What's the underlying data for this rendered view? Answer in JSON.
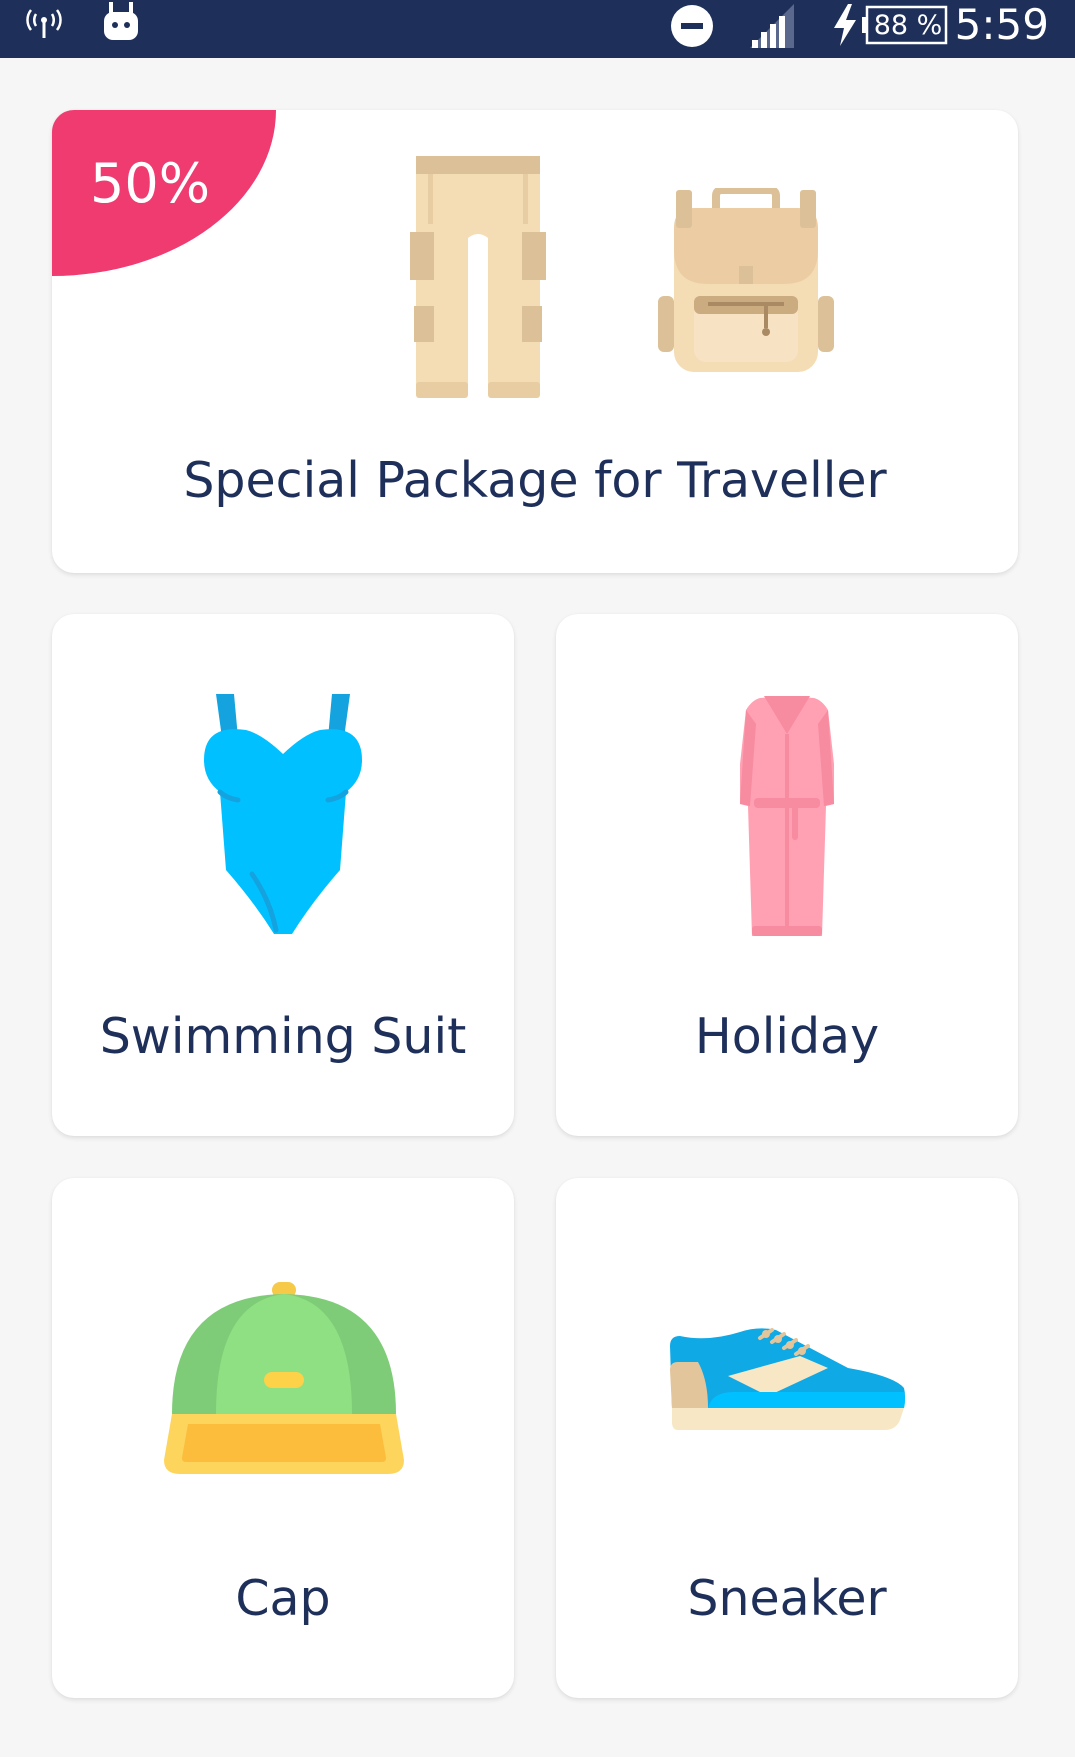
{
  "status_bar": {
    "time": "5:59",
    "battery": "88 %",
    "icons": [
      "hotspot-icon",
      "android-debug-icon",
      "do-not-disturb-icon",
      "signal-icon",
      "charging-icon",
      "battery-icon"
    ]
  },
  "featured": {
    "badge": "50%",
    "title": "Special Package for Traveller",
    "icons": [
      "pants-icon",
      "backpack-icon"
    ]
  },
  "categories": [
    {
      "label": "Swimming Suit",
      "icon": "swimsuit-icon"
    },
    {
      "label": "Holiday",
      "icon": "robe-icon"
    },
    {
      "label": "Cap",
      "icon": "cap-icon"
    },
    {
      "label": "Sneaker",
      "icon": "sneaker-icon"
    }
  ],
  "colors": {
    "status_bar": "#1e2f5a",
    "text": "#1e2f5a",
    "badge": "#ef3b6f",
    "background": "#f6f6f6"
  }
}
